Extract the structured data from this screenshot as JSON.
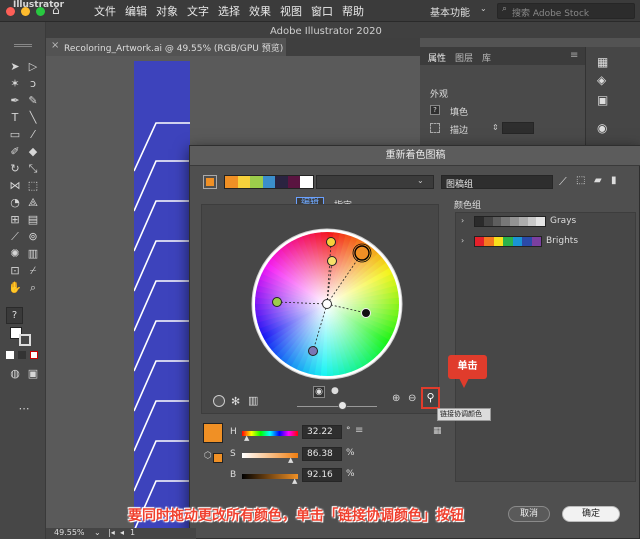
{
  "menubar": {
    "apple_logo": "apple-icon",
    "items": [
      "文件",
      "编辑",
      "对象",
      "文字",
      "选择",
      "效果",
      "视图",
      "窗口",
      "帮助"
    ],
    "app_title": "Adobe Illustrator 2020",
    "workspace": "基本功能",
    "stock_placeholder": "搜索 Adobe Stock",
    "watermark": "Illustrator"
  },
  "document": {
    "tab_label": "Recoloring_Artwork.ai @ 49.55% (RGB/GPU 预览)",
    "zoom": "49.55%",
    "page": "1"
  },
  "right_panel": {
    "tabs": [
      "属性",
      "图层",
      "库"
    ],
    "section_title": "外观",
    "fill_label": "填色",
    "stroke_label": "描边"
  },
  "dialog": {
    "title": "重新着色图稿",
    "mode_tabs": [
      "编辑",
      "指定"
    ],
    "group_select": "图稿组",
    "color_groups_label": "颜色组",
    "groups": [
      {
        "name": "Grays",
        "swatches": [
          "#2b2b2b",
          "#444444",
          "#5e5e5e",
          "#787878",
          "#939393",
          "#adadad",
          "#c8c8c8",
          "#e4e4e4"
        ]
      },
      {
        "name": "Brights",
        "swatches": [
          "#e5202a",
          "#f47920",
          "#f9e11c",
          "#2bb24c",
          "#1a94d5",
          "#2b4aa8",
          "#7b3fa0"
        ]
      }
    ],
    "palette_strip": [
      "#f09025",
      "#f7d13b",
      "#9ccd4b",
      "#3b8ecb",
      "#2a2340",
      "#5a1440",
      "#ffffff"
    ],
    "active_color": "#f09025",
    "hsb": {
      "h_label": "H",
      "h_value": "32.22",
      "h_unit": "°",
      "s_label": "S",
      "s_value": "86.38",
      "s_unit": "%",
      "b_label": "B",
      "b_value": "92.16",
      "b_unit": "%"
    },
    "cancel_label": "取消",
    "ok_label": "确定"
  },
  "annotation": {
    "callout": "单击",
    "tooltip": "链接协调颜色",
    "caption": "要同时拖动更改所有颜色，单击「链接协调颜色」按钮"
  }
}
